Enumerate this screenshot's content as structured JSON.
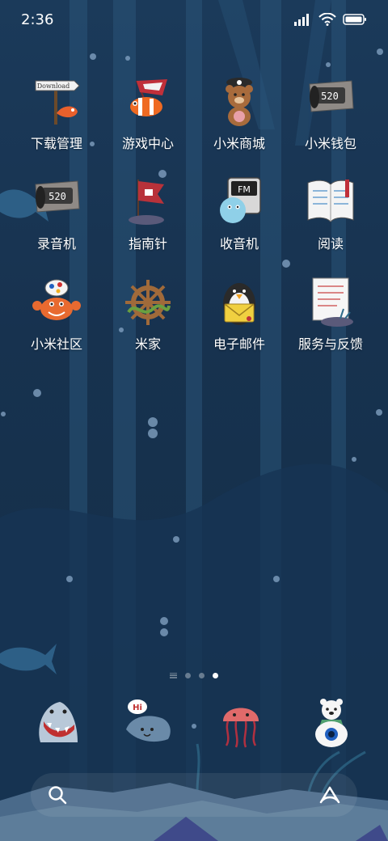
{
  "status_bar": {
    "time": "2:36",
    "icons": [
      "signal-icon",
      "wifi-icon",
      "battery-icon"
    ]
  },
  "apps": [
    {
      "label": "下载管理",
      "icon": "download-sign-icon",
      "badge_text": "Download"
    },
    {
      "label": "游戏中心",
      "icon": "clownfish-flag-icon"
    },
    {
      "label": "小米商城",
      "icon": "pirate-bear-icon"
    },
    {
      "label": "小米钱包",
      "icon": "wooden-sign-wallet-icon",
      "badge_text": "520"
    },
    {
      "label": "录音机",
      "icon": "wooden-sign-recorder-icon",
      "badge_text": "520"
    },
    {
      "label": "指南针",
      "icon": "red-flag-compass-icon"
    },
    {
      "label": "收音机",
      "icon": "pufferfish-radio-icon",
      "badge_text": "FM"
    },
    {
      "label": "阅读",
      "icon": "open-book-icon"
    },
    {
      "label": "小米社区",
      "icon": "crab-icon"
    },
    {
      "label": "米家",
      "icon": "ship-wheel-icon"
    },
    {
      "label": "电子邮件",
      "icon": "penguin-mail-icon"
    },
    {
      "label": "服务与反馈",
      "icon": "note-paper-icon"
    }
  ],
  "page_indicator": {
    "pages": 4,
    "active_index": 3
  },
  "dock": [
    {
      "icon": "shark-phone-icon"
    },
    {
      "icon": "stingray-messages-icon",
      "badge_text": "Hi"
    },
    {
      "icon": "jellyfish-camera-icon"
    },
    {
      "icon": "polar-bear-browser-icon"
    }
  ],
  "search_bar": {
    "left_icon": "search-icon",
    "right_icon": "assistant-icon"
  },
  "colors": {
    "background": "#1b3a5a",
    "label": "#ffffff"
  }
}
